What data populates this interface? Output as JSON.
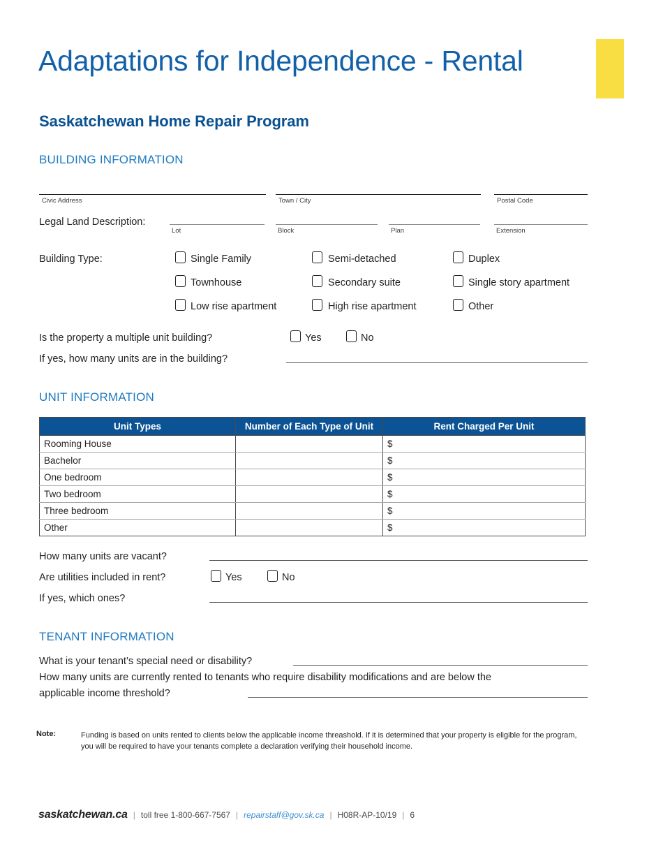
{
  "header": {
    "title": "Adaptations for Independence - Rental",
    "subtitle": "Saskatchewan Home Repair Program",
    "accent_yellow": "#f8dd43",
    "title_color": "#1260a8",
    "subtitle_color": "#0a5192"
  },
  "sections": {
    "building": "BUILDING INFORMATION",
    "unit": "UNIT INFORMATION",
    "tenant": "TENANT INFORMATION",
    "heading_color": "#1e7ac0"
  },
  "address": {
    "civic_address_caption": "Civic Address",
    "town_city_caption": "Town / City",
    "postal_code_caption": "Postal Code"
  },
  "legal_land": {
    "label": "Legal Land Description:",
    "lot_caption": "Lot",
    "block_caption": "Block",
    "plan_caption": "Plan",
    "extension_caption": "Extension"
  },
  "building_type": {
    "label": "Building Type:",
    "options": [
      "Single Family",
      "Semi-detached",
      "Duplex",
      "Townhouse",
      "Secondary suite",
      "Single story apartment",
      "Low rise apartment",
      "High rise apartment",
      "Other"
    ]
  },
  "multiple_unit": {
    "question": "Is the property a multiple unit building?",
    "yes": "Yes",
    "no": "No",
    "followup": "If yes, how many units are in the building?"
  },
  "unit_table": {
    "columns": [
      "Unit Types",
      "Number of Each Type of Unit",
      "Rent Charged Per Unit"
    ],
    "header_color": "#0b5394",
    "rows": [
      {
        "type": "Rooming House",
        "count": "",
        "rent": "$"
      },
      {
        "type": "Bachelor",
        "count": "",
        "rent": "$"
      },
      {
        "type": "One bedroom",
        "count": "",
        "rent": "$"
      },
      {
        "type": "Two bedroom",
        "count": "",
        "rent": "$"
      },
      {
        "type": "Three bedroom",
        "count": "",
        "rent": "$"
      },
      {
        "type": "Other",
        "count": "",
        "rent": "$"
      }
    ]
  },
  "vacancy": {
    "vacant_question": "How many units are vacant?",
    "utilities_question": "Are utilities included in rent?",
    "yes": "Yes",
    "no": "No",
    "which_ones_question": "If yes, which ones?"
  },
  "tenant": {
    "special_need_question": "What is your tenant’s special need or disability?",
    "rented_question_line1": "How many units are currently rented to tenants who require disability modifications and are below the",
    "rented_question_line2": "applicable income threshold?"
  },
  "note": {
    "label": "Note:",
    "text": "Funding is based on units rented to clients below the applicable income threashold. If it is determined that your property is eligible for the program, you will be required to have your tenants complete a declaration verifying their household income."
  },
  "footer": {
    "brand": "saskatchewan.ca",
    "sep": "|",
    "toll_free": "toll free 1-800-667-7567",
    "email": "repairstaff@gov.sk.ca",
    "form_code": "H08R-AP-10/19",
    "page_number": "6"
  }
}
